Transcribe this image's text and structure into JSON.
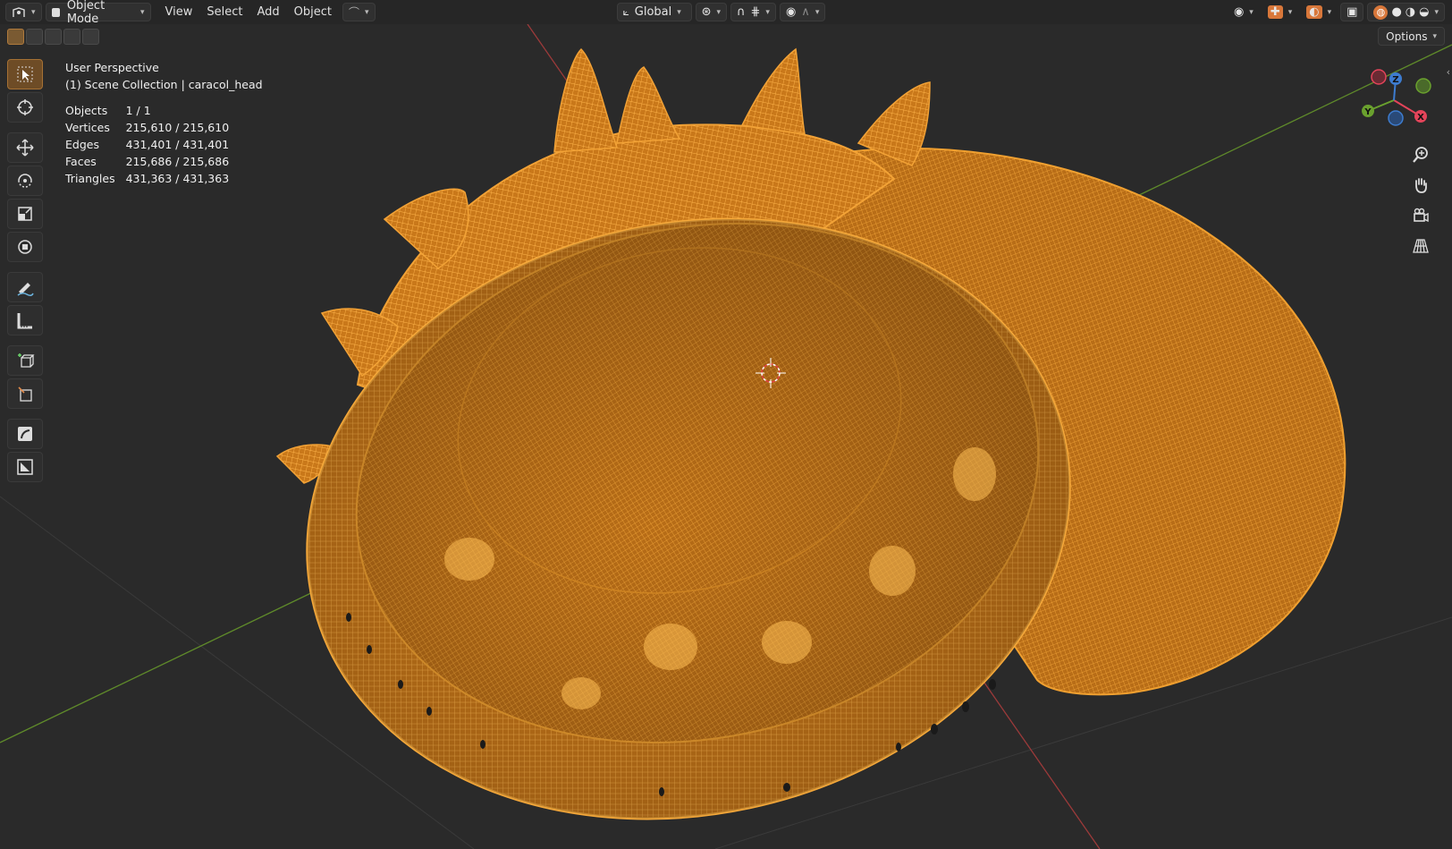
{
  "header": {
    "mode": "Object Mode",
    "menus": [
      "View",
      "Select",
      "Add",
      "Object"
    ],
    "transform_orientation": "Global",
    "options_label": "Options"
  },
  "stats": {
    "perspective": "User Perspective",
    "collection": "(1) Scene Collection | caracol_head",
    "rows": [
      {
        "label": "Objects",
        "value": "1 / 1"
      },
      {
        "label": "Vertices",
        "value": "215,610 / 215,610"
      },
      {
        "label": "Edges",
        "value": "431,401 / 431,401"
      },
      {
        "label": "Faces",
        "value": "215,686 / 215,686"
      },
      {
        "label": "Triangles",
        "value": "431,363 / 431,363"
      }
    ]
  },
  "tools": [
    "select-box",
    "cursor",
    "move",
    "rotate",
    "scale",
    "transform",
    "annotate",
    "measure",
    "add-cube",
    "add-shape",
    "shear",
    "region"
  ],
  "gizmo": {
    "axes": [
      "X",
      "Y",
      "Z"
    ],
    "colors": {
      "x": "#e4445a",
      "y": "#6aa12e",
      "z": "#3d7ccf"
    }
  },
  "colors": {
    "mesh": "#e08a1e",
    "wire": "#f7a430",
    "background": "#2a2a2a",
    "x_axis": "#9c3a3a",
    "y_axis": "#5f8a2a"
  }
}
